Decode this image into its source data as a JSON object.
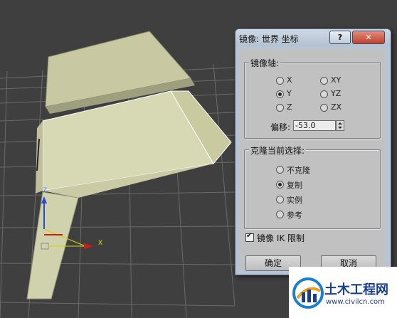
{
  "dialog": {
    "title": "镜像: 世界 坐标",
    "help_label": "?",
    "close_label": "✕",
    "mirror_axis": {
      "label": "镜像轴:",
      "options": [
        {
          "label": "X",
          "selected": false
        },
        {
          "label": "XY",
          "selected": false
        },
        {
          "label": "Y",
          "selected": true
        },
        {
          "label": "YZ",
          "selected": false
        },
        {
          "label": "Z",
          "selected": false
        },
        {
          "label": "ZX",
          "selected": false
        }
      ],
      "offset_label": "偏移:",
      "offset_value": "-53.0"
    },
    "clone_selection": {
      "label": "克隆当前选择:",
      "options": [
        {
          "label": "不克隆",
          "selected": false
        },
        {
          "label": "复制",
          "selected": true
        },
        {
          "label": "实例",
          "selected": false
        },
        {
          "label": "参考",
          "selected": false
        }
      ]
    },
    "ik_limit": {
      "label": "镜像 IK 限制",
      "checked": true
    },
    "ok_label": "确定",
    "cancel_label": "取消"
  },
  "viewport": {
    "gizmo": {
      "axis_z": "Z",
      "axis_x": "X"
    }
  },
  "watermark": {
    "name": "土木工程网",
    "url": "www.civilcn.com"
  },
  "colors": {
    "viewport_bg": "#3f3f3f",
    "model_fill": "#d7d8b4",
    "dialog_bg": "#c1c1c1",
    "title_bg": "#b7c4d3",
    "close_red": "#c2402c",
    "brand_blue": "#1a3f8c"
  }
}
